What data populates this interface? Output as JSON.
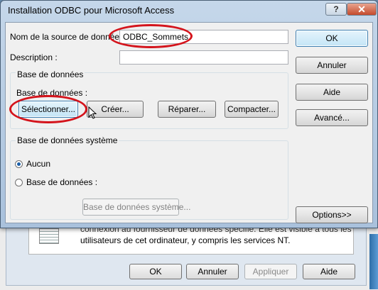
{
  "dialog": {
    "title": "Installation ODBC pour Microsoft Access",
    "help_button": "?",
    "close_button": "✕",
    "source_label": "Nom de la source de données :",
    "source_value": "ODBC_Sommets",
    "description_label": "Description :",
    "description_value": "",
    "database_group": {
      "title": "Base de données",
      "db_label": "Base de données :",
      "buttons": {
        "select": "Sélectionner...",
        "create": "Créer...",
        "repair": "Réparer...",
        "compact": "Compacter..."
      }
    },
    "system_group": {
      "title": "Base de données système",
      "radio_none": "Aucun",
      "radio_db": "Base de données :",
      "system_db_button": "Base de données système..."
    },
    "side_buttons": {
      "ok": "OK",
      "cancel": "Annuler",
      "help": "Aide",
      "advanced": "Avancé...",
      "options": "Options>>"
    },
    "highlight_color": "#d4141c"
  },
  "background_window": {
    "description_line1": "connexion au fournisseur de données spécifié. Elle est visible à tous les",
    "description_line2": "utilisateurs de cet ordinateur, y compris les services NT.",
    "buttons": {
      "ok": "OK",
      "cancel": "Annuler",
      "apply": "Appliquer",
      "help": "Aide"
    }
  }
}
